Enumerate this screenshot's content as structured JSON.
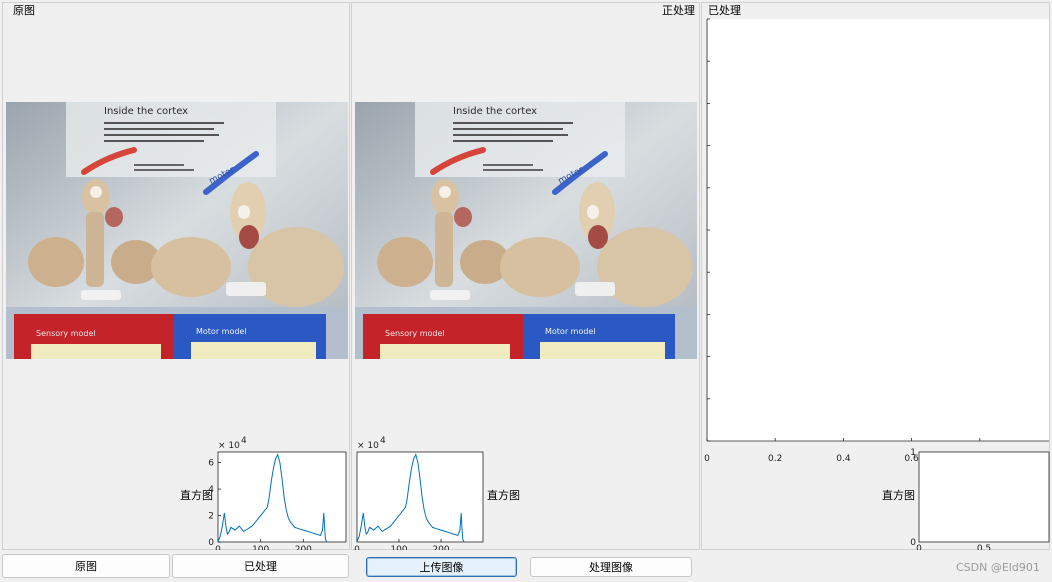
{
  "panels": {
    "original_title": "原图",
    "processing_title": "正处理",
    "processed_title": "已处理"
  },
  "photo": {
    "heading": "Inside the cortex",
    "label_left": "Sensory model",
    "label_right": "Motor model",
    "word_motor": "motor"
  },
  "histogram": {
    "label": "直方图",
    "exponent_base": "× 10",
    "exponent_power": "4",
    "y_ticks": [
      "0",
      "2",
      "4",
      "6"
    ],
    "x_ticks": [
      "0",
      "100",
      "200"
    ]
  },
  "histogram_right": {
    "label": "直方图",
    "y_ticks": [
      "0",
      "1"
    ],
    "x_ticks": [
      "0",
      "0.5"
    ]
  },
  "empty_axes": {
    "x_ticks": [
      "0",
      "0.2",
      "0.4",
      "0.6",
      "0.8"
    ]
  },
  "buttons": {
    "original": "原图",
    "processed": "已处理",
    "upload": "上传图像",
    "process": "处理图像"
  },
  "watermark": "CSDN @Eld901",
  "chart_data": {
    "type": "line",
    "title": "",
    "xlabel": "",
    "ylabel": "",
    "xlim": [
      0,
      300
    ],
    "ylim": [
      0,
      6.8
    ],
    "y_multiplier": "×10^4",
    "x": [
      0,
      5,
      10,
      15,
      18,
      22,
      25,
      30,
      40,
      50,
      60,
      70,
      80,
      90,
      100,
      105,
      110,
      115,
      118,
      120,
      125,
      130,
      135,
      140,
      145,
      150,
      155,
      160,
      165,
      170,
      175,
      180,
      190,
      200,
      210,
      220,
      230,
      240,
      245,
      248,
      250,
      252,
      255
    ],
    "series": [
      {
        "values": [
          0.05,
          0.4,
          1.2,
          2.2,
          1.3,
          0.6,
          0.7,
          1.1,
          0.9,
          1.2,
          0.8,
          1.0,
          1.2,
          1.6,
          2.0,
          2.2,
          2.4,
          2.6,
          3.0,
          3.4,
          4.6,
          5.6,
          6.3,
          6.6,
          6.0,
          4.8,
          3.4,
          2.4,
          1.8,
          1.5,
          1.3,
          1.1,
          1.0,
          0.9,
          0.8,
          0.7,
          0.6,
          0.5,
          0.9,
          2.2,
          1.0,
          0.2,
          0.0
        ]
      }
    ]
  }
}
